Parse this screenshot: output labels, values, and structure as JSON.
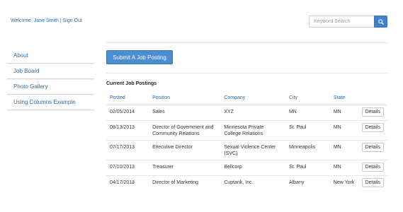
{
  "header": {
    "welcome_text": "Welcome, Jane Smith",
    "separator": "|",
    "signout_label": "Sign Out"
  },
  "search": {
    "placeholder": "Keyword Search",
    "icon": "search-icon",
    "button_color": "#3f83c7"
  },
  "sidebar": {
    "items": [
      {
        "label": "About"
      },
      {
        "label": "Job Board"
      },
      {
        "label": "Photo Gallery"
      },
      {
        "label": "Using Columns Example"
      }
    ]
  },
  "main": {
    "submit_label": "Submit A Job Posting",
    "section_title": "Current Job Postings",
    "columns": [
      "Posted",
      "Position",
      "Company",
      "City",
      "State",
      ""
    ],
    "rows": [
      {
        "posted": "02/05/2014",
        "position": "Sales",
        "company": "XYZ",
        "city": "MN",
        "state": "MN",
        "action": "Details"
      },
      {
        "posted": "08/13/2013",
        "position": "Director of Government and Community Relations",
        "company": "Minnesota Private College Relations",
        "city": "St. Paul",
        "state": "MN",
        "action": "Details"
      },
      {
        "posted": "07/17/2013",
        "position": "Executive Director",
        "company": "Sexual Violence Center (SVC)",
        "city": "Minneapolis",
        "state": "MN",
        "action": "Details"
      },
      {
        "posted": "07/10/2013",
        "position": "Treasurer",
        "company": "Bellcorp",
        "city": "St. Paul",
        "state": "MN",
        "action": "Details"
      },
      {
        "posted": "04/17/2013",
        "position": "Director of Marketing",
        "company": "Cuptank, Inc.",
        "city": "Albany",
        "state": "New York",
        "action": "Details"
      }
    ]
  },
  "colors": {
    "link": "#2f6aa6",
    "primary_button": "#4a8ed0"
  }
}
